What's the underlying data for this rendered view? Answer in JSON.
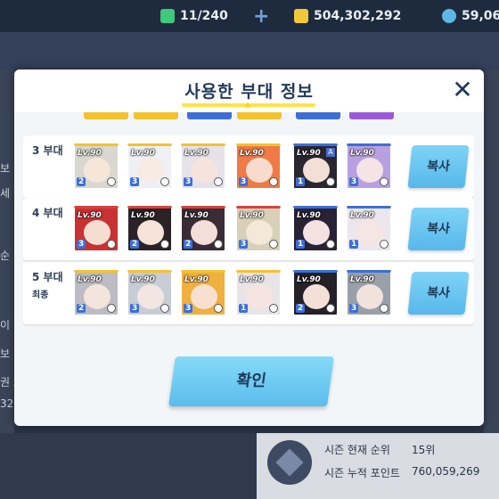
{
  "resources": {
    "ap": "11/240",
    "credits": "504,302,292",
    "pyroxene": "59,06",
    "colors": {
      "ap": "#3fc97a",
      "credits": "#f0c93a",
      "pyroxene": "#5fb6e6"
    }
  },
  "background": {
    "left_fragments": [
      "보",
      "세",
      "순",
      "이",
      "보",
      "권 포",
      "32"
    ],
    "season_rank_label": "시즌 현재 순위",
    "season_rank_value": "15위",
    "season_points_label": "시즌 누적 포인트",
    "season_points_value": "760,059,269"
  },
  "modal": {
    "title": "사용한 부대 정보",
    "close_icon": "close-icon",
    "squads": [
      {
        "label": "3 부대",
        "sub": "",
        "copy": "복사",
        "cards": [
          {
            "lv": "Lv.90",
            "star": "2",
            "stripe": "#f2c230",
            "hair": "#d8d8d0",
            "face": "#f6e6da"
          },
          {
            "lv": "Lv.90",
            "star": "3",
            "stripe": "#f2c230",
            "hair": "#eef0f4",
            "face": "#f7ebe4"
          },
          {
            "lv": "Lv.90",
            "star": "3",
            "stripe": "#f2c230",
            "hair": "#e6e2ea",
            "face": "#f5e3dc"
          },
          {
            "lv": "Lv.90",
            "star": "3",
            "stripe": "#f2c230",
            "hair": "#f07a46",
            "face": "#f7dccd"
          },
          {
            "lv": "Lv.90",
            "star": "1",
            "stripe": "#3d6fd6",
            "hair": "#2a2630",
            "face": "#f3dfd6",
            "tag": "A"
          },
          {
            "lv": "Lv.90",
            "star": "3",
            "stripe": "#3d6fd6",
            "hair": "#b9a0e0",
            "face": "#f5e3e6"
          }
        ]
      },
      {
        "label": "4 부대",
        "sub": "",
        "copy": "복사",
        "cards": [
          {
            "lv": "Lv.90",
            "star": "3",
            "stripe": "#d8423c",
            "hair": "#c83232",
            "face": "#f6ddd2"
          },
          {
            "lv": "Lv.90",
            "star": "2",
            "stripe": "#d8423c",
            "hair": "#2a2226",
            "face": "#f6e2d8"
          },
          {
            "lv": "Lv.90",
            "star": "2",
            "stripe": "#d8423c",
            "hair": "#3a2c36",
            "face": "#f4ded8"
          },
          {
            "lv": "Lv.90",
            "star": "3",
            "stripe": "#d8423c",
            "hair": "#d8d0b8",
            "face": "#f4e8d8"
          },
          {
            "lv": "Lv.90",
            "star": "1",
            "stripe": "#3d6fd6",
            "hair": "#282236",
            "face": "#f4e2e2"
          },
          {
            "lv": "Lv.90",
            "star": "1",
            "stripe": "#3d6fd6",
            "hair": "#ece6ee",
            "face": "#f5e6e4"
          }
        ]
      },
      {
        "label": "5 부대",
        "sub": "최종",
        "copy": "복사",
        "cards": [
          {
            "lv": "Lv.90",
            "star": "2",
            "stripe": "#f2c230",
            "hair": "#bdbcc4",
            "face": "#f3e4dc"
          },
          {
            "lv": "Lv.90",
            "star": "3",
            "stripe": "#f2c230",
            "hair": "#c8ccd4",
            "face": "#f2e6e2"
          },
          {
            "lv": "Lv.90",
            "star": "3",
            "stripe": "#f2c230",
            "hair": "#f0b040",
            "face": "#f7e0d0"
          },
          {
            "lv": "Lv.90",
            "star": "1",
            "stripe": "#f2c230",
            "hair": "#e8e4e8",
            "face": "#f6e4e0"
          },
          {
            "lv": "Lv.90",
            "star": "2",
            "stripe": "#3d6fd6",
            "hair": "#262028",
            "face": "#f5e0d8"
          },
          {
            "lv": "Lv.90",
            "star": "3",
            "stripe": "#3d6fd6",
            "hair": "#9aa0aa",
            "face": "#f1e2dc"
          }
        ]
      }
    ],
    "confirm": "확인"
  }
}
